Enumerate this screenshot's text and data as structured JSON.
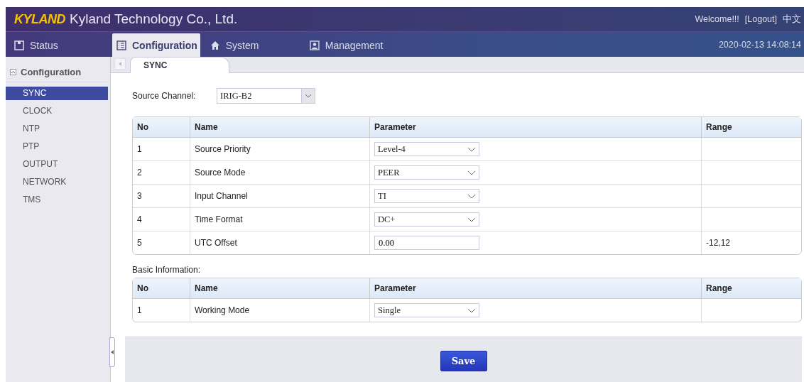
{
  "header": {
    "logo": "KYLAND",
    "title": "Kyland Technology Co., Ltd.",
    "welcome": "Welcome!!!",
    "logout": "[Logout]",
    "language": "中文"
  },
  "nav": {
    "tabs": [
      {
        "label": "Status",
        "selected": false
      },
      {
        "label": "Configuration",
        "selected": true
      },
      {
        "label": "System",
        "selected": false
      },
      {
        "label": "Management",
        "selected": false
      }
    ],
    "datetime": "2020-02-13 14:08:14"
  },
  "sidebar": {
    "title": "Configuration",
    "expanded": true,
    "items": [
      {
        "label": "SYNC",
        "selected": true
      },
      {
        "label": "CLOCK",
        "selected": false
      },
      {
        "label": "NTP",
        "selected": false
      },
      {
        "label": "PTP",
        "selected": false
      },
      {
        "label": "OUTPUT",
        "selected": false
      },
      {
        "label": "NETWORK",
        "selected": false
      },
      {
        "label": "TMS",
        "selected": false
      }
    ]
  },
  "page_tabs": [
    {
      "label": "SYNC",
      "selected": true
    }
  ],
  "source_channel": {
    "label": "Source Channel:",
    "value": "IRIG-B2"
  },
  "table": {
    "columns": [
      "No",
      "Name",
      "Parameter",
      "Range"
    ],
    "rows": [
      {
        "no": "1",
        "name": "Source Priority",
        "kind": "select",
        "value": "Level-4"
      },
      {
        "no": "2",
        "name": "Source Mode",
        "kind": "select",
        "value": "PEER"
      },
      {
        "no": "3",
        "name": "Input Channel",
        "kind": "select",
        "value": "TI"
      },
      {
        "no": "4",
        "name": "Time Format",
        "kind": "select",
        "value": "DC+"
      },
      {
        "no": "5",
        "name": "UTC Offset",
        "kind": "input",
        "value": "0.00",
        "range": "-12,12"
      }
    ]
  },
  "basic_info": {
    "label": "Basic Information:",
    "columns": [
      "No",
      "Name",
      "Parameter",
      "Range"
    ],
    "rows": [
      {
        "no": "1",
        "name": "Working Mode",
        "kind": "select",
        "value": "Single"
      }
    ]
  },
  "save_button": "Save"
}
